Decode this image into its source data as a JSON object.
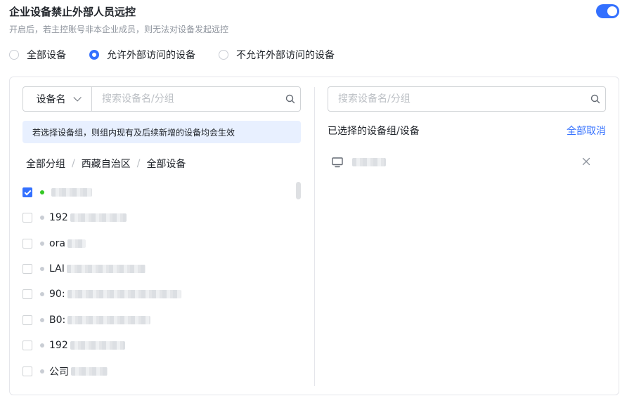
{
  "header": {
    "title": "企业设备禁止外部人员远控",
    "subtitle": "开启后，若主控账号非本企业成员，则无法对设备发起远控",
    "toggle_on": true,
    "accent_color": "#3370ff"
  },
  "radios": [
    {
      "label": "全部设备",
      "checked": false
    },
    {
      "label": "允许外部访问的设备",
      "checked": true
    },
    {
      "label": "不允许外部访问的设备",
      "checked": false
    }
  ],
  "left": {
    "select_label": "设备名",
    "search_placeholder": "搜索设备名/分组",
    "info": "若选择设备组，则组内现有及后续新增的设备均会生效",
    "breadcrumb": [
      "全部分组",
      "西藏自治区",
      "全部设备"
    ],
    "devices": [
      {
        "prefix": "",
        "checked": true,
        "online": true
      },
      {
        "prefix": "192",
        "checked": false,
        "online": false
      },
      {
        "prefix": "ora",
        "checked": false,
        "online": false
      },
      {
        "prefix": "LAI",
        "checked": false,
        "online": false
      },
      {
        "prefix": "90:",
        "checked": false,
        "online": false
      },
      {
        "prefix": "B0:",
        "checked": false,
        "online": false
      },
      {
        "prefix": "192",
        "checked": false,
        "online": false
      },
      {
        "prefix": "公司",
        "checked": false,
        "online": false
      }
    ]
  },
  "right": {
    "search_placeholder": "搜索设备名/分组",
    "title": "已选择的设备组/设备",
    "clear_all": "全部取消"
  }
}
